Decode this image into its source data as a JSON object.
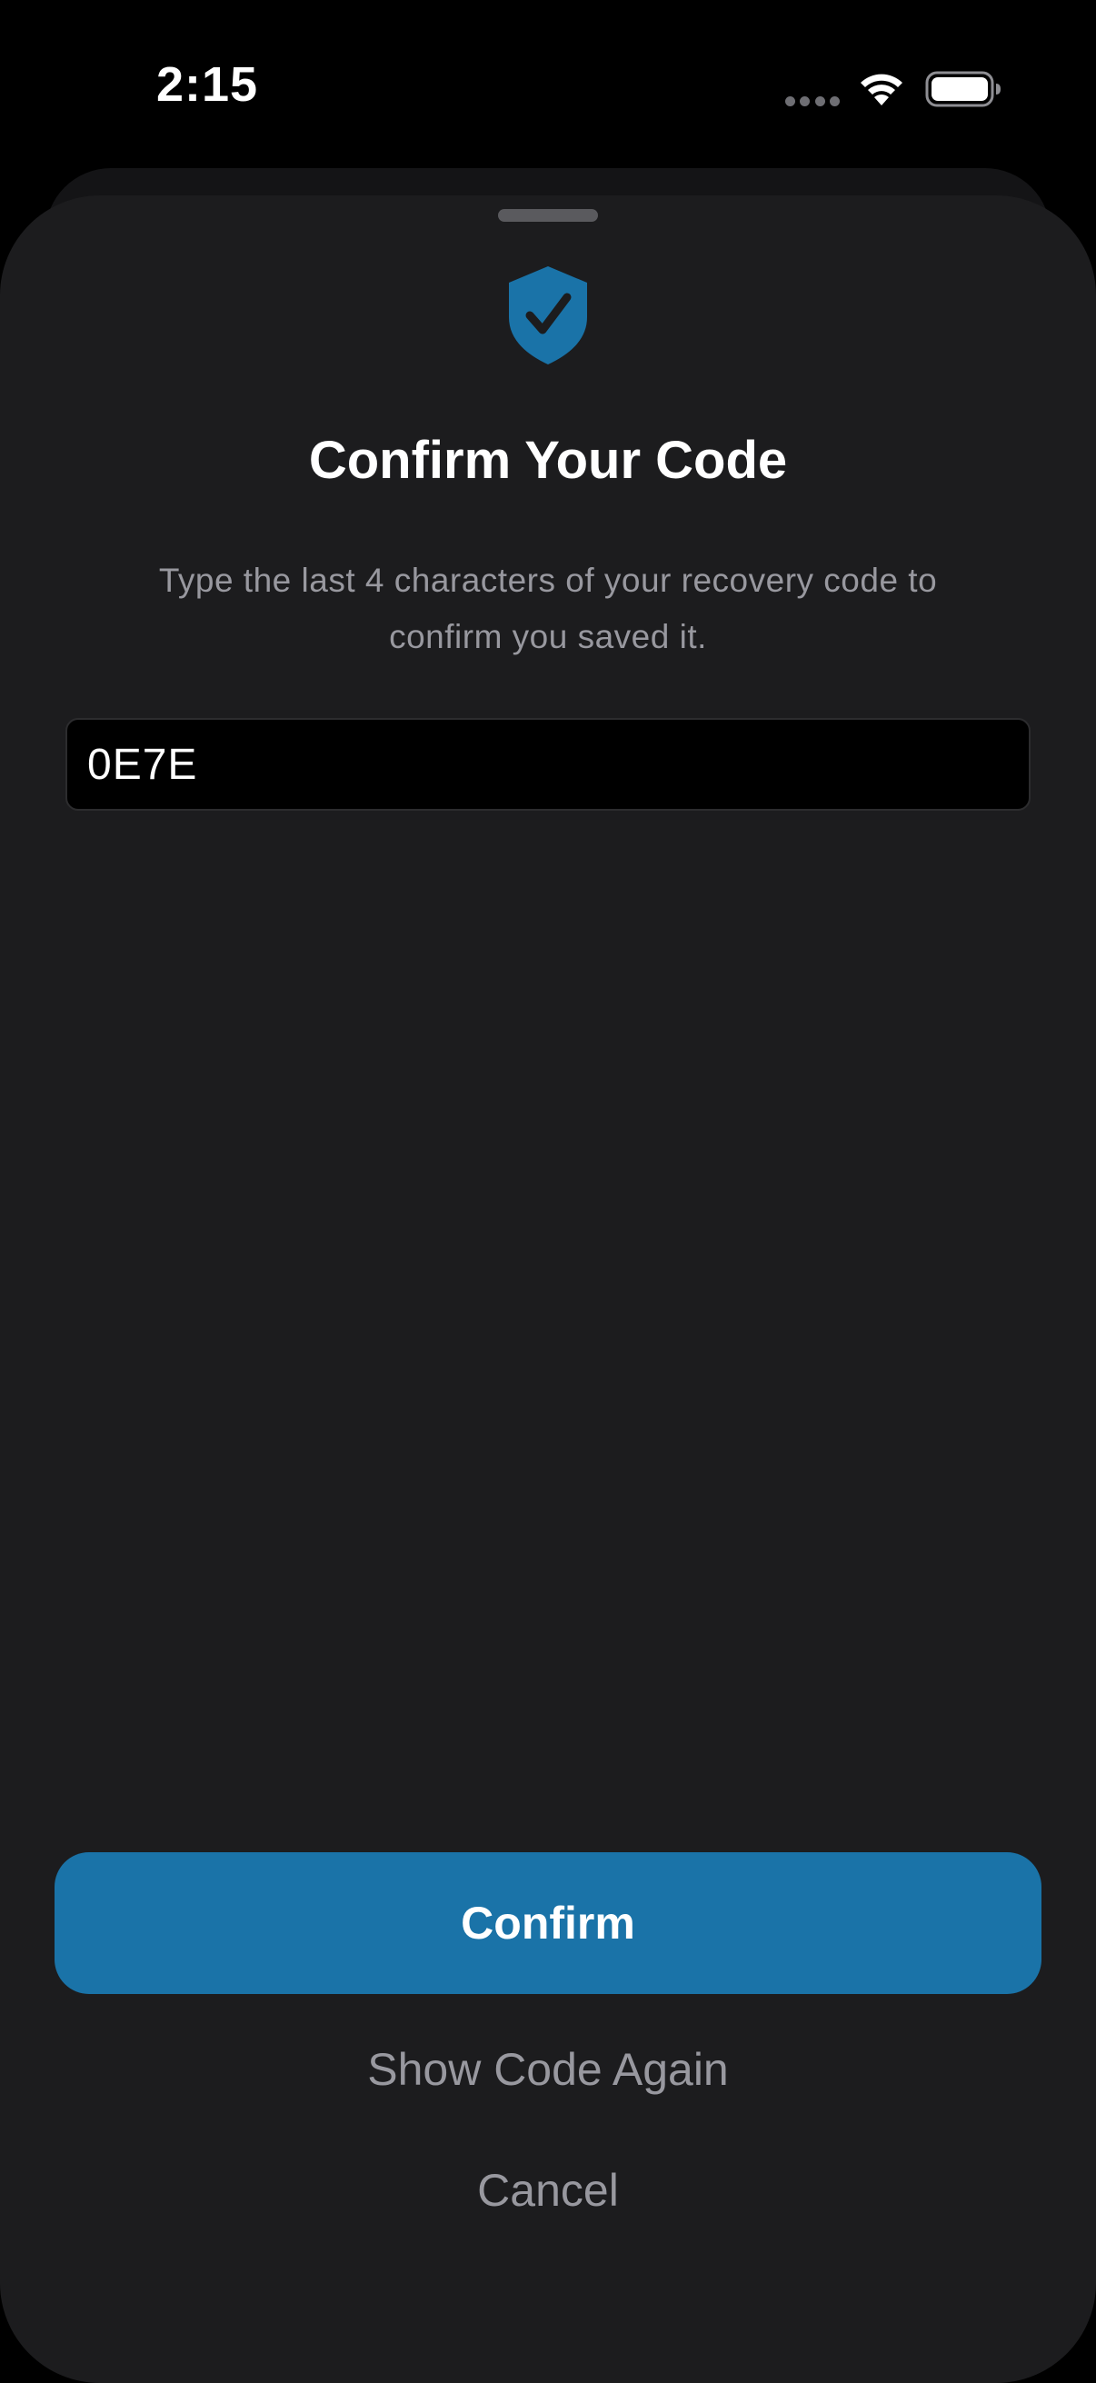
{
  "status_bar": {
    "time": "2:15",
    "icons": [
      "signal-dots-icon",
      "wifi-icon",
      "battery-icon"
    ]
  },
  "sheet": {
    "icon": "shield-check-icon",
    "title": "Confirm Your Code",
    "subtitle": "Type the last 4 characters of your recovery code to confirm you saved it.",
    "code_field": {
      "value": "0E7E"
    },
    "confirm_label": "Confirm",
    "show_code_label": "Show Code Again",
    "cancel_label": "Cancel"
  },
  "colors": {
    "accent": "#1a73a8",
    "sheet_background": "#1c1c1e",
    "secondary_text": "#98989f"
  }
}
